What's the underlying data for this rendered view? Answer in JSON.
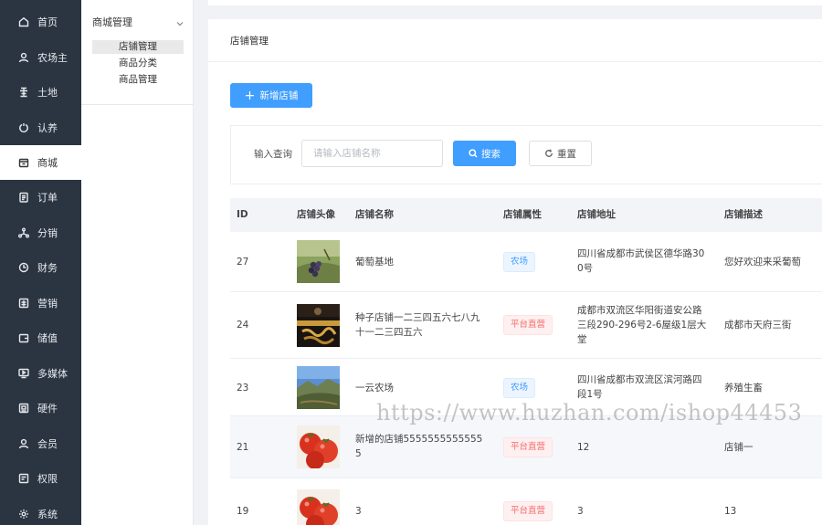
{
  "sidebar": {
    "items": [
      {
        "label": "首页",
        "icon": "home-icon"
      },
      {
        "label": "农场主",
        "icon": "user-icon"
      },
      {
        "label": "土地",
        "icon": "land-icon"
      },
      {
        "label": "认养",
        "icon": "adopt-icon"
      },
      {
        "label": "商城",
        "icon": "store-icon",
        "active": true
      },
      {
        "label": "订单",
        "icon": "order-icon"
      },
      {
        "label": "分销",
        "icon": "distribution-icon"
      },
      {
        "label": "财务",
        "icon": "finance-icon"
      },
      {
        "label": "营销",
        "icon": "marketing-icon"
      },
      {
        "label": "储值",
        "icon": "wallet-icon"
      },
      {
        "label": "多媒体",
        "icon": "media-icon"
      },
      {
        "label": "硬件",
        "icon": "hardware-icon"
      },
      {
        "label": "会员",
        "icon": "member-icon"
      },
      {
        "label": "权限",
        "icon": "permission-icon"
      },
      {
        "label": "系统",
        "icon": "gear-icon"
      }
    ]
  },
  "subnav": {
    "group": "商城管理",
    "items": [
      "店铺管理",
      "商品分类",
      "商品管理"
    ]
  },
  "page": {
    "title": "店铺管理",
    "add_label": "新增店铺",
    "search_label": "输入查询",
    "search_placeholder": "请输入店铺名称",
    "search_value": "",
    "search_button": "搜索",
    "reset_button": "重置"
  },
  "table": {
    "columns": [
      "ID",
      "店铺头像",
      "店铺名称",
      "店铺属性",
      "店铺地址",
      "店铺描述"
    ],
    "rows": [
      {
        "id": "27",
        "image": "grape-vineyard-photo",
        "name": "葡萄基地",
        "attr": "农场",
        "attr_type": "farm",
        "address": "四川省成都市武侯区德华路300号",
        "desc": "您好欢迎来采葡萄"
      },
      {
        "id": "24",
        "image": "dark-banner-photo",
        "name": "种子店铺一二三四五六七八九十一二三四五六",
        "attr": "平台直营",
        "attr_type": "platform",
        "address": "成都市双流区华阳街道安公路三段290-296号2-6屋级1层大堂",
        "desc": "成都市天府三街"
      },
      {
        "id": "23",
        "image": "mountain-landscape-photo",
        "name": "一云农场",
        "attr": "农场",
        "attr_type": "farm",
        "address": "四川省成都市双流区滨河路四段1号",
        "desc": "养殖生畜"
      },
      {
        "id": "21",
        "image": "tomato-photo",
        "name": "新增的店铺55555555555555",
        "attr": "平台直营",
        "attr_type": "platform",
        "address": "12",
        "desc": "店铺一"
      },
      {
        "id": "19",
        "image": "tomato-photo",
        "name": "3",
        "attr": "平台直营",
        "attr_type": "platform",
        "address": "3",
        "desc": "13"
      }
    ]
  },
  "watermark": "https://www.huzhan.com/ishop44453",
  "colors": {
    "sidebar_bg": "#2b3542",
    "primary": "#409eff",
    "farm_tag": "#409eff",
    "platform_tag": "#f56c6c"
  }
}
